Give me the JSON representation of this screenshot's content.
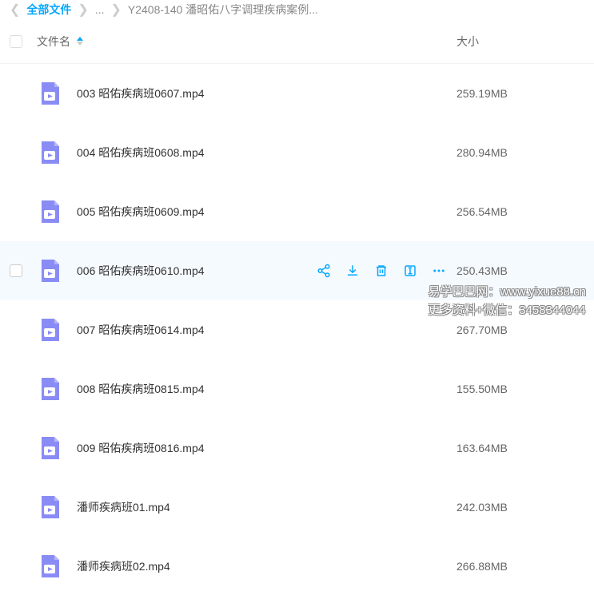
{
  "breadcrumb": {
    "root": "全部文件",
    "ellipsis": "...",
    "current": "Y2408-140 潘昭佑八字调理疾病案例..."
  },
  "columns": {
    "name": "文件名",
    "size": "大小"
  },
  "files": [
    {
      "name": "003 昭佑疾病班0607.mp4",
      "size": "259.19MB",
      "hovered": false
    },
    {
      "name": "004 昭佑疾病班0608.mp4",
      "size": "280.94MB",
      "hovered": false
    },
    {
      "name": "005 昭佑疾病班0609.mp4",
      "size": "256.54MB",
      "hovered": false
    },
    {
      "name": "006 昭佑疾病班0610.mp4",
      "size": "250.43MB",
      "hovered": true
    },
    {
      "name": "007 昭佑疾病班0614.mp4",
      "size": "267.70MB",
      "hovered": false
    },
    {
      "name": "008 昭佑疾病班0815.mp4",
      "size": "155.50MB",
      "hovered": false
    },
    {
      "name": "009 昭佑疾病班0816.mp4",
      "size": "163.64MB",
      "hovered": false
    },
    {
      "name": "潘师疾病班01.mp4",
      "size": "242.03MB",
      "hovered": false
    },
    {
      "name": "潘师疾病班02.mp4",
      "size": "266.88MB",
      "hovered": false
    }
  ],
  "watermark": {
    "line1": "易学巴巴网：www.yixue88.cn",
    "line2": "更多资料+微信：3458344044"
  }
}
